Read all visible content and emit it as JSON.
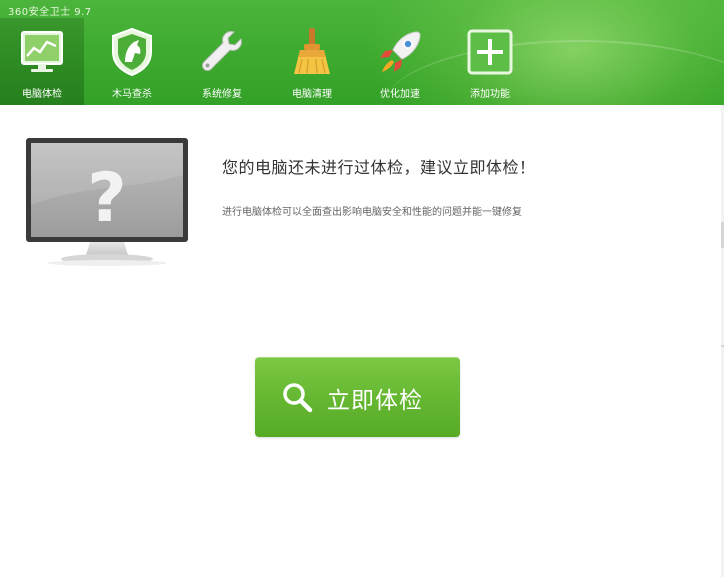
{
  "window": {
    "title": "360安全卫士 9.7"
  },
  "nav": {
    "items": [
      {
        "label": "电脑体检",
        "icon": "pc-checkup-icon",
        "active": true
      },
      {
        "label": "木马查杀",
        "icon": "trojan-shield-icon",
        "active": false
      },
      {
        "label": "系统修复",
        "icon": "wrench-icon",
        "active": false
      },
      {
        "label": "电脑清理",
        "icon": "broom-icon",
        "active": false
      },
      {
        "label": "优化加速",
        "icon": "rocket-icon",
        "active": false
      },
      {
        "label": "添加功能",
        "icon": "plus-icon",
        "active": false
      }
    ]
  },
  "main": {
    "headline": "您的电脑还未进行过体检，建议立即体检！",
    "description": "进行电脑体检可以全面查出影响电脑安全和性能的问题并能一键修复",
    "scan_button_label": "立即体检"
  },
  "colors": {
    "header_green": "#3da92f",
    "button_green": "#66b832",
    "active_tab": "#2a7a1f"
  }
}
